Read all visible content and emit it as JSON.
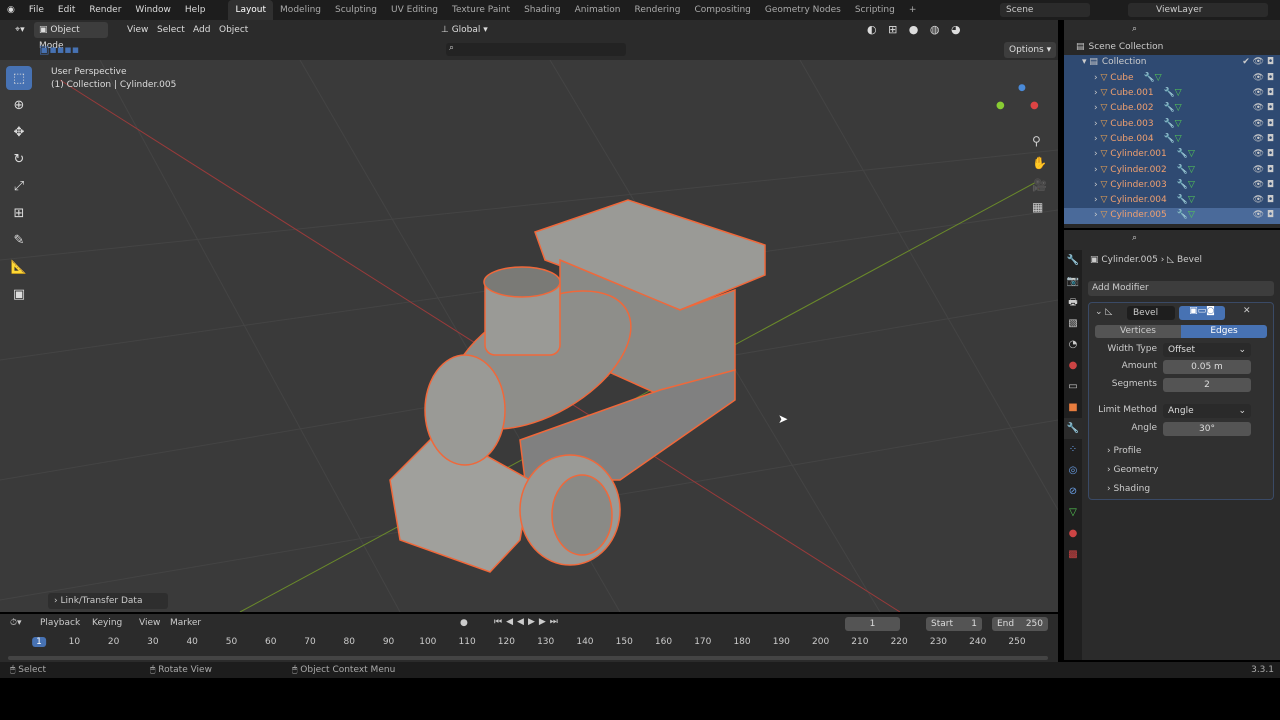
{
  "topbar": {
    "menus": [
      "File",
      "Edit",
      "Render",
      "Window",
      "Help"
    ],
    "workspaces": [
      "Layout",
      "Modeling",
      "Sculpting",
      "UV Editing",
      "Texture Paint",
      "Shading",
      "Animation",
      "Rendering",
      "Compositing",
      "Geometry Nodes",
      "Scripting"
    ],
    "active_workspace": "Layout",
    "add_tab": "+",
    "scene": "Scene",
    "view_layer": "ViewLayer"
  },
  "viewport_header": {
    "mode": "Object Mode",
    "menus": [
      "View",
      "Select",
      "Add",
      "Object"
    ],
    "orientation": "Global",
    "options": "Options"
  },
  "viewport": {
    "perspective": "User Perspective",
    "collection_info": "(1) Collection | Cylinder.005",
    "last_op": "Link/Transfer Data"
  },
  "outliner": {
    "root": "Scene Collection",
    "collection": "Collection",
    "items": [
      "Cube",
      "Cube.001",
      "Cube.002",
      "Cube.003",
      "Cube.004",
      "Cylinder.001",
      "Cylinder.002",
      "Cylinder.003",
      "Cylinder.004",
      "Cylinder.005"
    ],
    "active": "Cylinder.005"
  },
  "properties": {
    "object": "Cylinder.005",
    "modifier_crumb": "Bevel",
    "add_modifier": "Add Modifier",
    "modifier_name": "Bevel",
    "affect": [
      "Vertices",
      "Edges"
    ],
    "affect_active": "Edges",
    "width_type_label": "Width Type",
    "width_type": "Offset",
    "amount_label": "Amount",
    "amount": "0.05 m",
    "segments_label": "Segments",
    "segments": "2",
    "limit_method_label": "Limit Method",
    "limit_method": "Angle",
    "angle_label": "Angle",
    "angle": "30°",
    "panels": [
      "Profile",
      "Geometry",
      "Shading"
    ]
  },
  "timeline": {
    "menus": [
      "Playback",
      "Keying",
      "View",
      "Marker"
    ],
    "current_frame": "1",
    "start_label": "Start",
    "start": "1",
    "end_label": "End",
    "end": "250",
    "ticks": [
      "1",
      "10",
      "20",
      "30",
      "40",
      "50",
      "60",
      "70",
      "80",
      "90",
      "100",
      "110",
      "120",
      "130",
      "140",
      "150",
      "160",
      "170",
      "180",
      "190",
      "200",
      "210",
      "220",
      "230",
      "240",
      "250"
    ]
  },
  "status": {
    "select": "Select",
    "rotate": "Rotate View",
    "context": "Object Context Menu",
    "version": "3.3.1"
  },
  "colors": {
    "accent": "#4772b3",
    "selection": "#f0683a"
  }
}
